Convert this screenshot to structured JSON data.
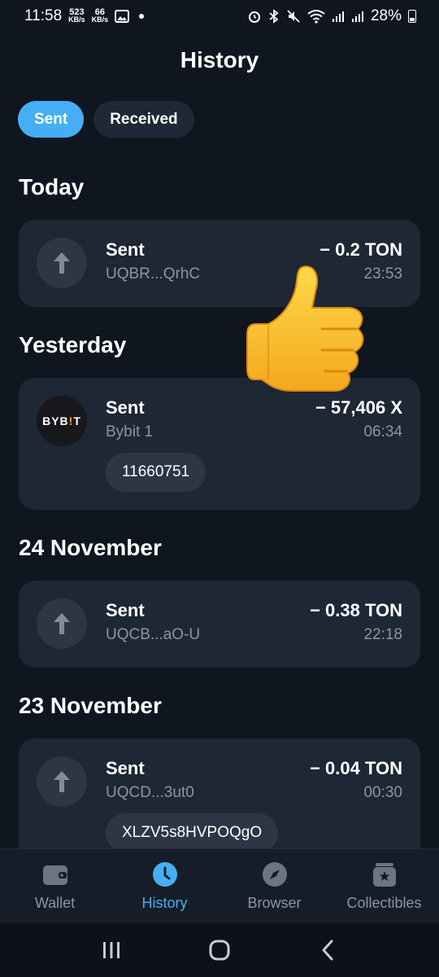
{
  "status_bar": {
    "time": "11:58",
    "speed_up": "523",
    "speed_down": "66",
    "speed_unit": "KB/s",
    "battery": "28%"
  },
  "header": {
    "title": "History"
  },
  "tabs": [
    {
      "label": "Sent",
      "active": true
    },
    {
      "label": "Received",
      "active": false
    }
  ],
  "sections": [
    {
      "title": "Today",
      "transactions": [
        {
          "label": "Sent",
          "address": "UQBR...QrhC",
          "amount": "− 0.2 TON",
          "time": "23:53",
          "comment": null,
          "icon": "arrow-up-icon"
        }
      ]
    },
    {
      "title": "Yesterday",
      "transactions": [
        {
          "label": "Sent",
          "address": "Bybit 1",
          "amount": "− 57,406 X",
          "time": "06:34",
          "comment": "11660751",
          "icon": "bybit-logo"
        }
      ]
    },
    {
      "title": "24 November",
      "transactions": [
        {
          "label": "Sent",
          "address": "UQCB...aO-U",
          "amount": "− 0.38 TON",
          "time": "22:18",
          "comment": null,
          "icon": "arrow-up-icon"
        }
      ]
    },
    {
      "title": "23 November",
      "transactions": [
        {
          "label": "Sent",
          "address": "UQCD...3ut0",
          "amount": "− 0.04 TON",
          "time": "00:30",
          "comment": "XLZV5s8HVPOQgO",
          "icon": "arrow-up-icon"
        }
      ]
    }
  ],
  "bybit_logo": {
    "part1": "BYB",
    "part2": "!",
    "part3": "T"
  },
  "bottom_nav": [
    {
      "label": "Wallet",
      "icon": "wallet-icon",
      "active": false
    },
    {
      "label": "History",
      "icon": "clock-icon",
      "active": true
    },
    {
      "label": "Browser",
      "icon": "compass-icon",
      "active": false
    },
    {
      "label": "Collectibles",
      "icon": "collectibles-icon",
      "active": false
    }
  ],
  "colors": {
    "background": "#10161f",
    "card": "#1e2734",
    "accent": "#45aef5",
    "muted": "#8b95a3"
  }
}
